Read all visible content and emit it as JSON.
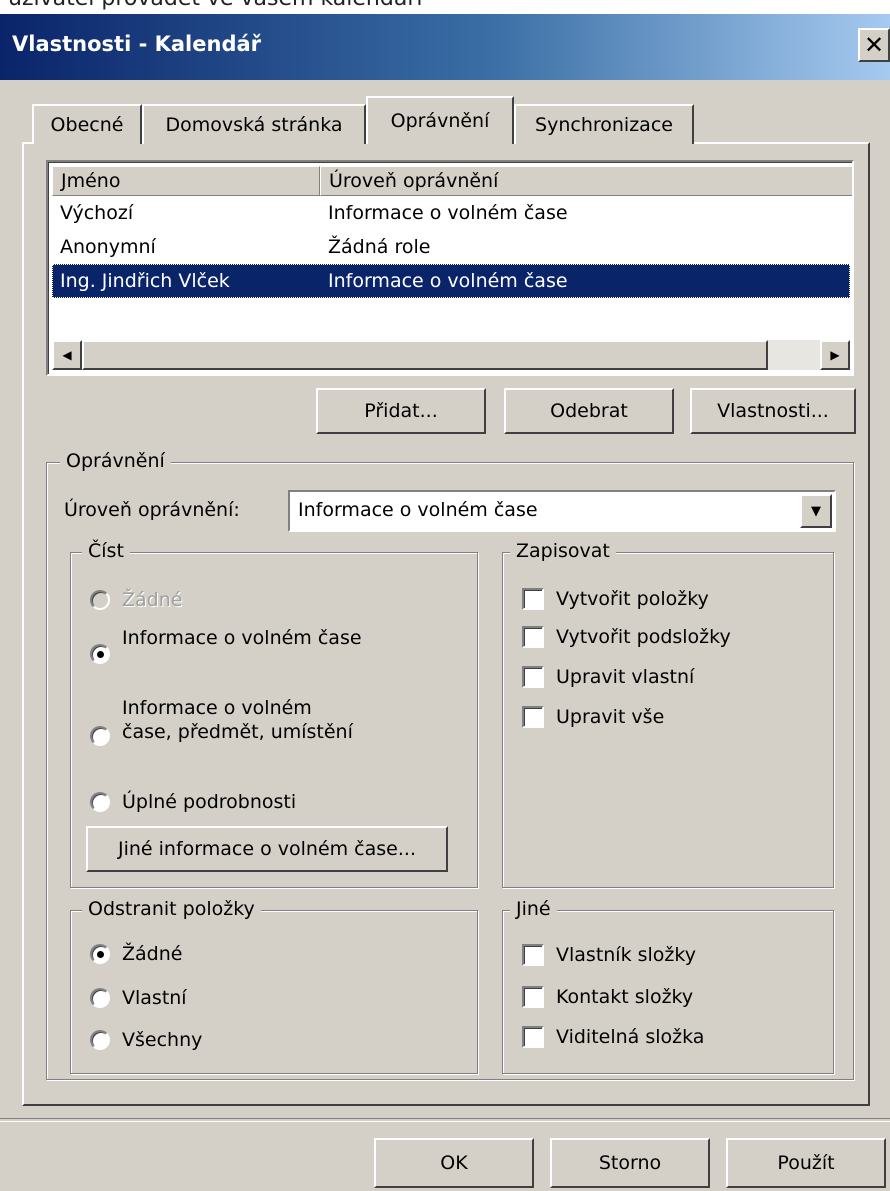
{
  "caption": "uživatel provádět ve vašem kalendáři",
  "window": {
    "title": "Vlastnosti - Kalendář",
    "close_label": "✕"
  },
  "tabs": [
    "Obecné",
    "Domovská stránka",
    "Oprávnění",
    "Synchronizace"
  ],
  "permissions_list": {
    "columns": [
      "Jméno",
      "Úroveň oprávnění"
    ],
    "rows": [
      {
        "name": "Výchozí",
        "level": "Informace o volném čase"
      },
      {
        "name": "Anonymní",
        "level": "Žádná role"
      },
      {
        "name": "Ing. Jindřich Vlček",
        "level": "Informace o volném čase",
        "selected": true
      }
    ]
  },
  "list_buttons": {
    "add": "Přidat...",
    "remove": "Odebrat",
    "properties": "Vlastnosti..."
  },
  "permissions_group": {
    "legend": "Oprávnění",
    "level_label": "Úroveň oprávnění:",
    "level_value": "Informace o volném čase"
  },
  "read_group": {
    "legend": "Číst",
    "options": [
      {
        "label": "Žádné",
        "checked": false,
        "disabled": true
      },
      {
        "label": "Informace o volném čase",
        "checked": true,
        "disabled": false
      },
      {
        "label": "Informace o volném čase, předmět, umístění",
        "checked": false,
        "disabled": false
      },
      {
        "label": "Úplné podrobnosti",
        "checked": false,
        "disabled": false
      }
    ],
    "other_button": "Jiné informace o volném čase..."
  },
  "write_group": {
    "legend": "Zapisovat",
    "options": [
      "Vytvořit položky",
      "Vytvořit podsložky",
      "Upravit vlastní",
      "Upravit vše"
    ]
  },
  "delete_group": {
    "legend": "Odstranit položky",
    "options": [
      {
        "label": "Žádné",
        "checked": true
      },
      {
        "label": "Vlastní",
        "checked": false
      },
      {
        "label": "Všechny",
        "checked": false
      }
    ]
  },
  "other_group": {
    "legend": "Jiné",
    "options": [
      "Vlastník složky",
      "Kontakt složky",
      "Viditelná složka"
    ]
  },
  "dialog_buttons": {
    "ok": "OK",
    "cancel": "Storno",
    "apply": "Použít"
  },
  "icons": {
    "scroll_left": "◀",
    "scroll_right": "▶",
    "dropdown": "▼"
  }
}
